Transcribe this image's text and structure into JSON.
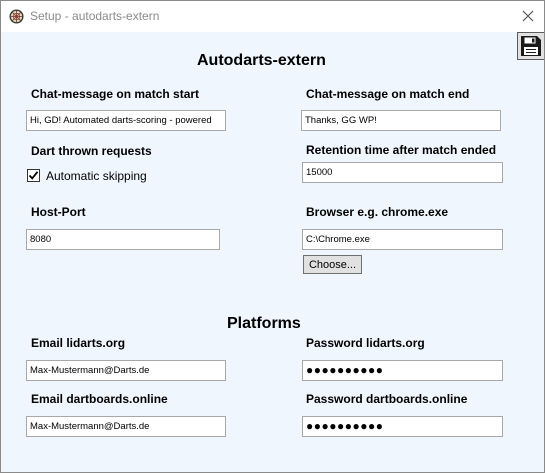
{
  "window": {
    "title": "Setup - autodarts-extern",
    "icon": "dartboard-icon",
    "close_icon": "close-icon",
    "save_icon": "floppy-disk-icon"
  },
  "section_autodarts": {
    "heading": "Autodarts-extern",
    "chat_start_label": "Chat-message on match start",
    "chat_start_value": "Hi, GD! Automated darts-scoring - powered",
    "chat_end_label": "Chat-message on match end",
    "chat_end_value": "Thanks, GG WP!",
    "dart_requests_label": "Dart thrown requests",
    "auto_skip_label": "Automatic skipping",
    "auto_skip_checked": true,
    "retention_label": "Retention time after match ended",
    "retention_value": "15000",
    "host_port_label": "Host-Port",
    "host_port_value": "8080",
    "browser_label": "Browser e.g. chrome.exe",
    "browser_value": "C:\\Chrome.exe",
    "choose_button": "Choose..."
  },
  "section_platforms": {
    "heading": "Platforms",
    "email_lidarts_label": "Email lidarts.org",
    "email_lidarts_value": "Max-Mustermann@Darts.de",
    "password_lidarts_label": "Password lidarts.org",
    "password_lidarts_value": "●●●●●●●●●●",
    "email_dartboards_label": "Email dartboards.online",
    "email_dartboards_value": "Max-Mustermann@Darts.de",
    "password_dartboards_label": "Password dartboards.online",
    "password_dartboards_value": "●●●●●●●●●●"
  },
  "colors": {
    "background": "#f0f6fd",
    "titlebar": "#ffffff",
    "button": "#e1e1e1"
  }
}
